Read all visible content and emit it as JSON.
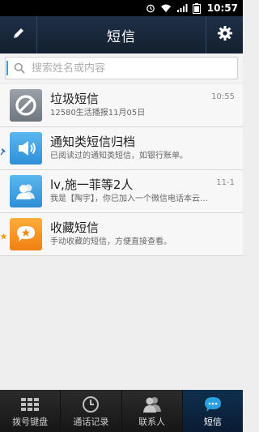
{
  "status_bar": {
    "time": "10:57"
  },
  "header": {
    "title": "短信"
  },
  "search": {
    "placeholder": "搜索姓名或内容"
  },
  "messages": [
    {
      "name": "垃圾短信",
      "preview": "12580生活播报11月05日",
      "time": "10:55",
      "icon": "block-icon",
      "pinned": false
    },
    {
      "name": "通知类短信归档",
      "preview": "已阅读过的通知类短信，如银行账单。",
      "time": "",
      "icon": "speaker-icon",
      "pinned": true
    },
    {
      "name": "lv,施一菲等2人",
      "preview": "我是【陶宇】，你已加入一个微信电话本云…",
      "time": "11-1",
      "icon": "contacts-icon",
      "pinned": false
    },
    {
      "name": "收藏短信",
      "preview": "手动收藏的短信，方便直接查看。",
      "time": "",
      "icon": "star-chat-icon",
      "pinned": false,
      "starred": true
    }
  ],
  "bottom_nav": [
    {
      "label": "拨号键盘",
      "icon": "dialpad-icon",
      "active": false
    },
    {
      "label": "通话记录",
      "icon": "clock-icon",
      "active": false
    },
    {
      "label": "联系人",
      "icon": "contacts-icon",
      "active": false
    },
    {
      "label": "短信",
      "icon": "chat-icon",
      "active": true
    }
  ],
  "colors": {
    "header_bg": "#1a2a3e",
    "accent": "#2aa0e0",
    "star": "#f39a1b"
  }
}
